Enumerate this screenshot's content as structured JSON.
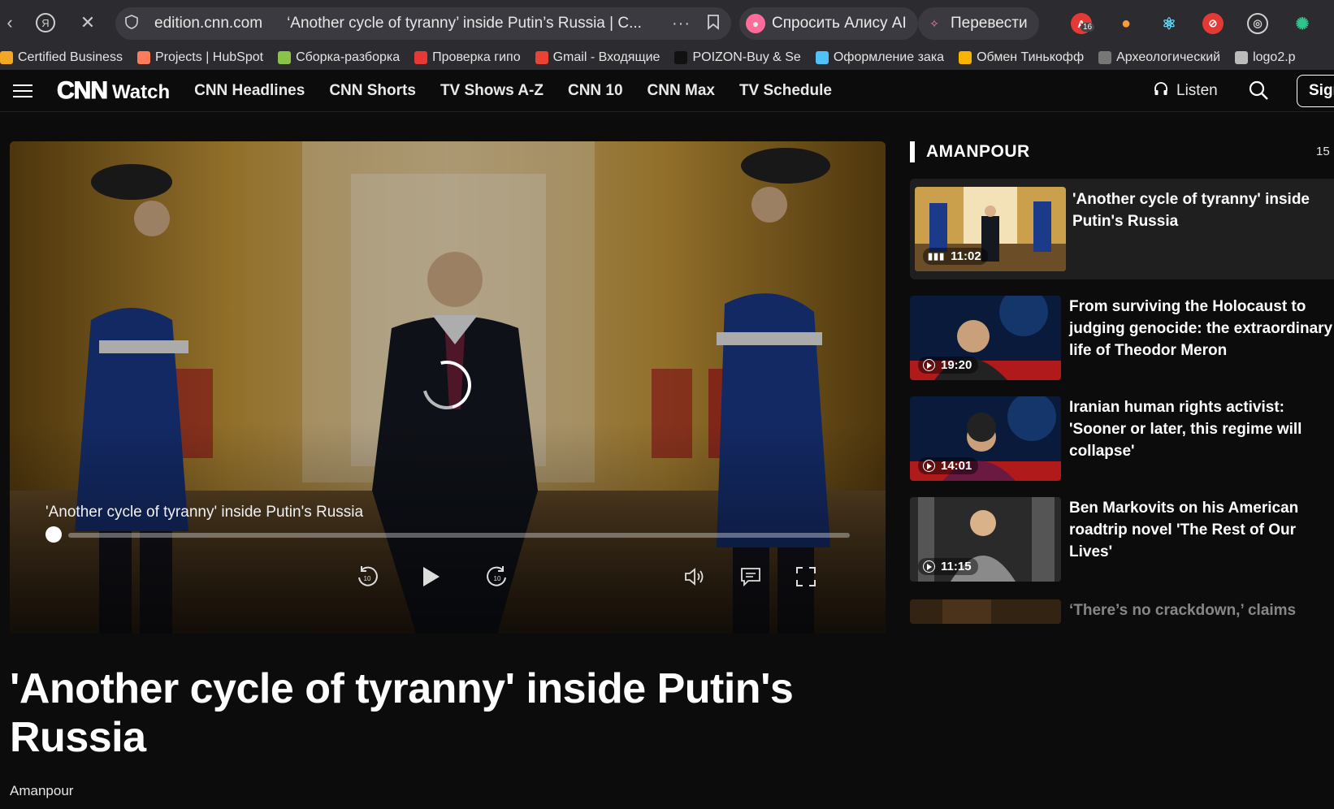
{
  "browser": {
    "domain": "edition.cnn.com",
    "page_title": "‘Another cycle of tyranny’ inside Putin’s Russia | C...",
    "more": "···",
    "alice_label": "Спросить Алису AI",
    "translate_label": "Перевести",
    "ext_badge": "16"
  },
  "bookmarks": [
    {
      "label": "Certified Business",
      "icon": "hubspot-icon",
      "color": "#f5a623"
    },
    {
      "label": "Projects | HubSpot",
      "icon": "hubspot-icon",
      "color": "#ff7a59"
    },
    {
      "label": "Сборка-разборка",
      "icon": "folder-icon",
      "color": "#8bc34a"
    },
    {
      "label": "Проверка гипо",
      "icon": "opera-icon",
      "color": "#e53935"
    },
    {
      "label": "Gmail - Входящие",
      "icon": "gmail-icon",
      "color": "#ea4335"
    },
    {
      "label": "POIZON-Buy & Se",
      "icon": "poizon-icon",
      "color": "#111111"
    },
    {
      "label": "Оформление зака",
      "icon": "shop-icon",
      "color": "#4fc3f7"
    },
    {
      "label": "Обмен Тинькофф",
      "icon": "coin-icon",
      "color": "#f7b500"
    },
    {
      "label": "Археологический",
      "icon": "cat-icon",
      "color": "#777777"
    },
    {
      "label": "logo2.p",
      "icon": "file-icon",
      "color": "#bbbbbb"
    }
  ],
  "nav": {
    "logo_cnn": "CNN",
    "logo_watch": "Watch",
    "links": [
      "CNN Headlines",
      "CNN Shorts",
      "TV Shows A-Z",
      "CNN 10",
      "CNN Max",
      "TV Schedule"
    ],
    "listen": "Listen",
    "signin": "Sign"
  },
  "player": {
    "title": "'Another cycle of tyranny' inside Putin's Russia",
    "progress": 0.0,
    "rewind_label": "10",
    "forward_label": "10"
  },
  "article": {
    "headline": "'Another cycle of tyranny' inside Putin's Russia",
    "show": "Amanpour"
  },
  "sidebar": {
    "heading": "AMANPOUR",
    "count": "15",
    "items": [
      {
        "title": "'Another cycle of tyranny' inside Putin's Russia",
        "duration": "11:02",
        "playing": true
      },
      {
        "title": "From surviving the Holocaust to judging genocide: the extraordinary life of Theodor Meron",
        "duration": "19:20",
        "playing": false
      },
      {
        "title": "Iranian human rights activist: 'Sooner or later, this regime will collapse'",
        "duration": "14:01",
        "playing": false
      },
      {
        "title": "Ben Markovits on his American roadtrip novel 'The Rest of Our Lives'",
        "duration": "11:15",
        "playing": false
      },
      {
        "title": "‘There’s no crackdown,’ claims",
        "duration": "",
        "playing": false
      }
    ]
  },
  "colors": {
    "page_bg": "#0c0c0c",
    "active_card": "#1f1f1f",
    "browser_chrome": "#2b2b30"
  }
}
